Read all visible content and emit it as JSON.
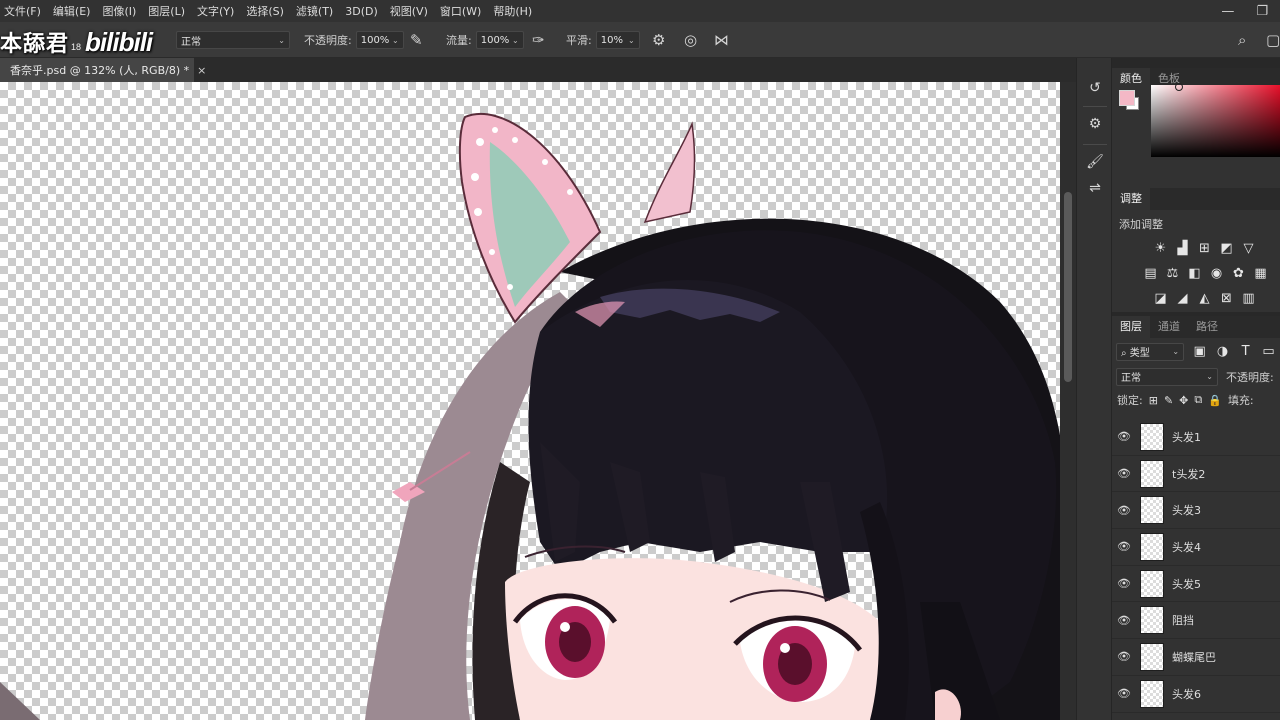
{
  "menu": [
    "文件(F)",
    "编辑(E)",
    "图像(I)",
    "图层(L)",
    "文字(Y)",
    "选择(S)",
    "滤镜(T)",
    "3D(D)",
    "视图(V)",
    "窗口(W)",
    "帮助(H)"
  ],
  "window_controls": {
    "minimize": "—",
    "restore": "❐"
  },
  "watermark": {
    "name": "本舔君",
    "number": "18",
    "logo": "bilibili"
  },
  "options": {
    "mode_value": "正常",
    "opacity_label": "不透明度:",
    "opacity_value": "100%",
    "flow_label": "流量:",
    "flow_value": "100%",
    "smoothing_label": "平滑:",
    "smoothing_value": "10%"
  },
  "document_tab": {
    "title": "香奈乎.psd @ 132% (人, RGB/8) *",
    "close": "×"
  },
  "color_panel": {
    "tabs": [
      "颜色",
      "色板"
    ],
    "foreground": "#f4b8c6",
    "background": "#ffffff"
  },
  "adjustments_panel": {
    "title": "调整",
    "subtitle": "添加调整"
  },
  "layers_panel": {
    "tabs": [
      "图层",
      "通道",
      "路径"
    ],
    "filter_label": "类型",
    "blend_mode": "正常",
    "opacity_label": "不透明度:",
    "lock_label": "锁定:",
    "fill_label": "填充:",
    "layers": [
      {
        "name": "头发1"
      },
      {
        "name": "t头发2"
      },
      {
        "name": "头发3"
      },
      {
        "name": "头发4"
      },
      {
        "name": "头发5"
      },
      {
        "name": "阻挡"
      },
      {
        "name": "蝴蝶尾巴"
      },
      {
        "name": "头发6"
      }
    ]
  }
}
